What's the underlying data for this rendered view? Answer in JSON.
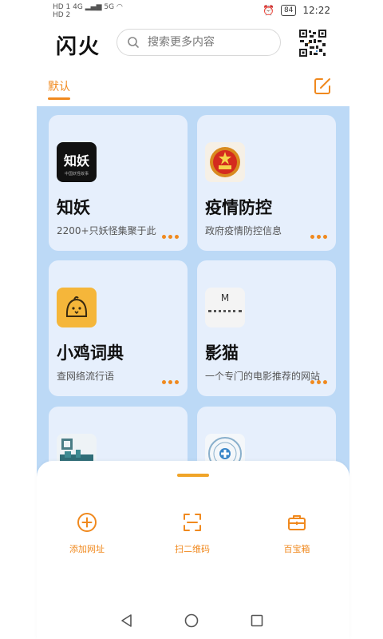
{
  "status_bar": {
    "sim1": "HD 1",
    "sim2": "HD 2",
    "signal1": "4G",
    "signal2": "5G",
    "battery": "84",
    "time": "12:22"
  },
  "header": {
    "title": "闪火",
    "search_placeholder": "搜索更多内容"
  },
  "tabs": {
    "default_label": "默认"
  },
  "cards": [
    {
      "title": "知妖",
      "desc": "2200+只妖怪集聚于此",
      "icon_text": "知妖",
      "icon_subtext": "中国妖怪故事",
      "icon": "zhiyao-logo"
    },
    {
      "title": "疫情防控",
      "desc": "政府疫情防控信息",
      "icon": "national-emblem-icon"
    },
    {
      "title": "小鸡词典",
      "desc": "查网络流行语",
      "icon": "chick-icon"
    },
    {
      "title": "影猫",
      "desc": "一个专门的电影推荐的网站",
      "icon_text": "M",
      "icon": "yingmao-logo"
    },
    {
      "title": "",
      "desc": "",
      "icon": "city-qr-icon"
    },
    {
      "title": "",
      "desc": "",
      "icon": "medical-seal-icon"
    }
  ],
  "bottom_sheet": {
    "actions": [
      {
        "label": "添加网址",
        "icon": "plus-circle-icon"
      },
      {
        "label": "扫二维码",
        "icon": "scan-icon"
      },
      {
        "label": "百宝箱",
        "icon": "briefcase-icon"
      }
    ]
  },
  "colors": {
    "accent": "#f0891e",
    "grid_background": "#bcd9f6",
    "card_background": "#e6effc"
  }
}
